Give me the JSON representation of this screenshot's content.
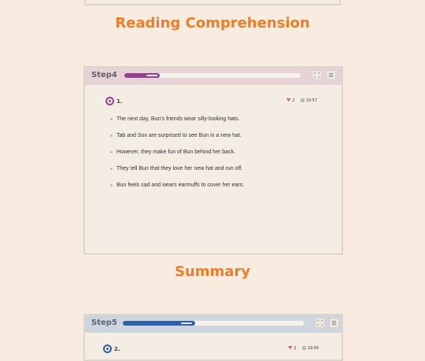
{
  "colors": {
    "page_bg": "#f8ece0",
    "accent_orange": "#ef7d27",
    "step4_header": "#e6d3d6",
    "step4_progress": "#944191",
    "step5_header": "#cdd5df",
    "step5_progress": "#2e5fa6",
    "heart": "#e35b6b"
  },
  "sections": {
    "reading_title": "Reading Comprehension",
    "summary_title": "Summary"
  },
  "step4": {
    "label": "Step4",
    "progress_fraction": 0.2,
    "question_number": "1.",
    "lives": "2",
    "timer": "19:57",
    "sentences": [
      "The next day, Bun's friends wear silly-looking hats.",
      "Tab and Sox are surprised to see Bun in a new hat.",
      "However, they make fun of Bun behind her back.",
      "They tell Bun that they love her new hat and run off.",
      "Bun feels sad and wears earmuffs to cover her ears."
    ],
    "icons": [
      "fullscreen-icon",
      "menu-icon",
      "heart-icon",
      "clock-icon"
    ]
  },
  "step5": {
    "label": "Step5",
    "progress_fraction": 0.4,
    "question_number": "2.",
    "lives": "2",
    "timer": "19:56"
  }
}
